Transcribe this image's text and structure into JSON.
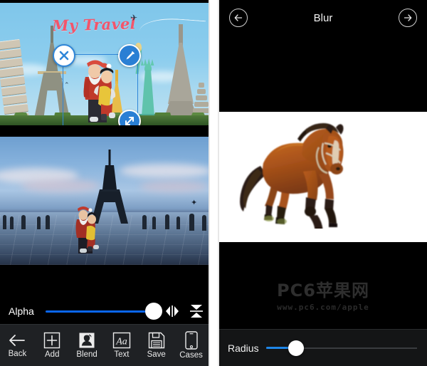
{
  "left_panel": {
    "canvas": {
      "title_text": "My Travel",
      "title_color": "#f2556b",
      "selection": {
        "close_icon": "close-x-icon",
        "edit_icon": "pencil-edit-icon",
        "scale_icon": "resize-diagonal-icon"
      }
    },
    "alpha_row": {
      "label": "Alpha",
      "value_percent": 97,
      "accent_color": "#0a66f0",
      "flip_horizontal_icon": "flip-horizontal-icon",
      "flip_vertical_icon": "flip-vertical-icon"
    },
    "toolbar": {
      "items": [
        {
          "label": "Back",
          "icon": "arrow-left-icon"
        },
        {
          "label": "Add",
          "icon": "plus-square-icon"
        },
        {
          "label": "Blend",
          "icon": "blend-portrait-icon"
        },
        {
          "label": "Text",
          "icon": "text-aa-icon"
        },
        {
          "label": "Save",
          "icon": "floppy-disk-icon"
        },
        {
          "label": "Cases",
          "icon": "phone-case-icon"
        }
      ]
    }
  },
  "right_panel": {
    "header": {
      "title": "Blur",
      "back_icon": "circle-arrow-left-icon",
      "forward_icon": "circle-arrow-right-icon"
    },
    "preview": {
      "subject": "horse-image",
      "background_color": "#ffffff"
    },
    "watermark": {
      "main": "PC6苹果网",
      "sub": "www.pc6.com/apple"
    },
    "slider_row": {
      "label": "Radius",
      "value_percent": 20,
      "accent_color": "#1e86e8"
    }
  }
}
